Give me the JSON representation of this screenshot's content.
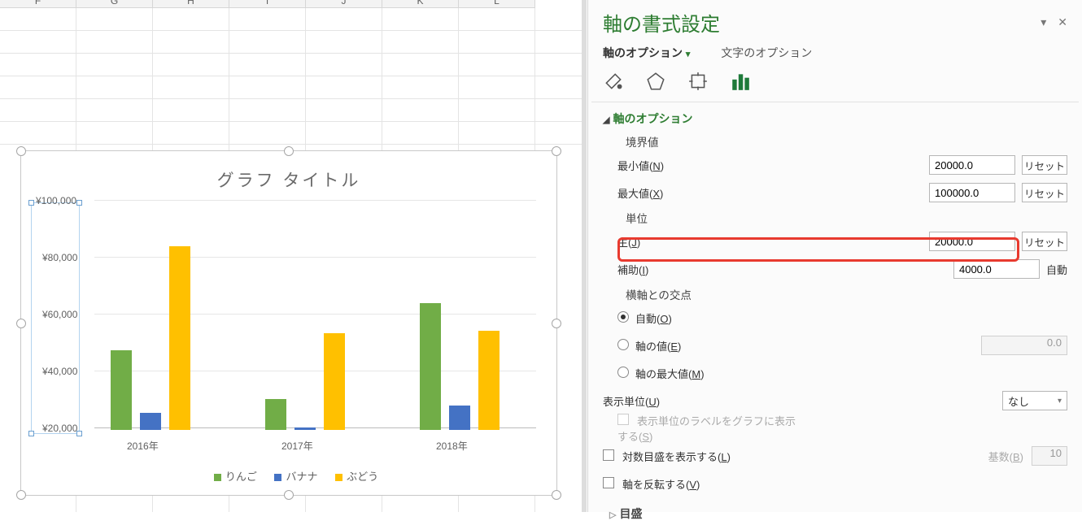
{
  "columns": [
    "F",
    "G",
    "H",
    "I",
    "J",
    "K",
    "L"
  ],
  "pane": {
    "title": "軸の書式設定",
    "tab_on": "軸のオプション",
    "tab_off": "文字のオプション",
    "sec_axis_options": "軸のオプション",
    "group_bounds": "境界値",
    "min_label": "最小値(",
    "min_key": "N",
    "max_label": "最大値(",
    "max_key": "X",
    "min_val": "20000.0",
    "max_val": "100000.0",
    "reset": "リセット",
    "group_units": "単位",
    "major_label": "主(",
    "major_key": "J",
    "minor_label": "補助(",
    "minor_key": "I",
    "major_val": "20000.0",
    "minor_val": "4000.0",
    "auto": "自動",
    "group_cross": "横軸との交点",
    "cross_auto": "自動(",
    "cross_auto_key": "O",
    "cross_val": "軸の値(",
    "cross_val_key": "E",
    "cross_val_input": "0.0",
    "cross_max": "軸の最大値(",
    "cross_max_key": "M",
    "display_units": "表示単位(",
    "display_units_key": "U",
    "display_units_val": "なし",
    "show_label_disabled": "表示単位のラベルをグラフに表示する(",
    "show_label_key": "S",
    "log_scale": "対数目盛を表示する(",
    "log_key": "L",
    "base_label": "基数(",
    "base_key": "B",
    "base_val": "10",
    "reverse": "軸を反転する(",
    "reverse_key": "V",
    "sec_ticks": "目盛"
  },
  "chart": {
    "title": "グラフ タイトル",
    "yticks": [
      "¥100,000",
      "¥80,000",
      "¥60,000",
      "¥40,000",
      "¥20,000"
    ],
    "xcats": [
      "2016年",
      "2017年",
      "2018年"
    ],
    "legend": [
      "りんご",
      "バナナ",
      "ぶどう"
    ]
  },
  "chart_data": {
    "type": "bar",
    "title": "グラフ タイトル",
    "ylabel": "",
    "xlabel": "",
    "ylim": [
      20000,
      100000
    ],
    "ygrid_step": 20000,
    "categories": [
      "2016年",
      "2017年",
      "2018年"
    ],
    "series": [
      {
        "name": "りんご",
        "color": "#71ad47",
        "values": [
          48000,
          31000,
          64500
        ]
      },
      {
        "name": "バナナ",
        "color": "#4472c4",
        "values": [
          26000,
          21000,
          28500
        ]
      },
      {
        "name": "ぶどう",
        "color": "#ffc000",
        "values": [
          84500,
          54000,
          55000
        ]
      }
    ]
  }
}
